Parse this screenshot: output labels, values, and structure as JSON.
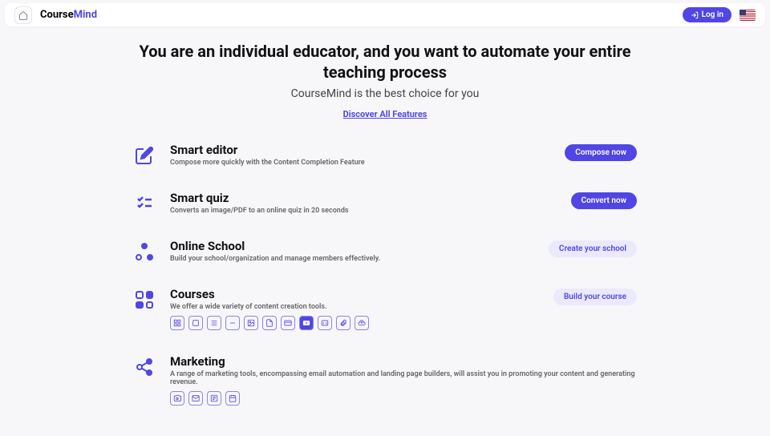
{
  "header": {
    "logo_a": "Course",
    "logo_b": "Mind",
    "login": "Log in"
  },
  "hero": {
    "title": "You are an individual educator, and you want to automate your entire teaching process",
    "subtitle": "CourseMind is the best choice for you",
    "link": "Discover All Features"
  },
  "features": [
    {
      "title": "Smart editor",
      "desc": "Compose more quickly with the Content Completion Feature",
      "btn": "Compose now",
      "btnStyle": "primary"
    },
    {
      "title": "Smart quiz",
      "desc": "Converts an image/PDF to an online quiz in 20 seconds",
      "btn": "Convert now",
      "btnStyle": "primary"
    },
    {
      "title": "Online School",
      "desc": "Build your school/organization and manage members effectively.",
      "btn": "Create your school",
      "btnStyle": "ghost"
    },
    {
      "title": "Courses",
      "desc": "We offer a wide variety of content creation tools.",
      "btn": "Build your course",
      "btnStyle": "ghost"
    },
    {
      "title": "Marketing",
      "desc": "A range of marketing tools, encompassing email automation and landing page builders, will assist you in promoting your content and generating revenue.",
      "btn": "",
      "btnStyle": ""
    }
  ],
  "course_tools": [
    "blocks",
    "square",
    "lines",
    "minus",
    "image",
    "file",
    "card",
    "video",
    "code",
    "attach",
    "cloud"
  ],
  "marketing_tools": [
    "camera",
    "mail",
    "list",
    "calendar"
  ]
}
